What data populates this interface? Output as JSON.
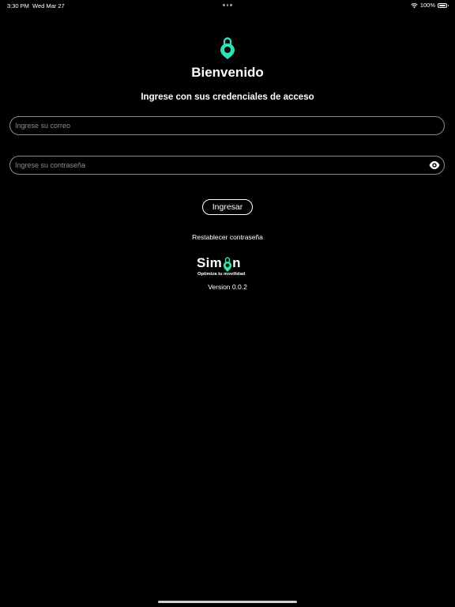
{
  "status_bar": {
    "time": "3:30 PM",
    "date": "Wed Mar 27",
    "battery_percent": "100%",
    "battery_level": 1.0
  },
  "brand": {
    "accent_color": "#2fe0b3",
    "icon": "location-pin-icon"
  },
  "login": {
    "title": "Bienvenido",
    "subtitle": "Ingrese con sus credenciales de acceso",
    "email_placeholder": "Ingrese su correo",
    "email_value": "",
    "password_placeholder": "Ingrese su contraseña",
    "password_value": "",
    "submit_label": "Ingresar",
    "reset_label": "Restablecer contraseña"
  },
  "logo": {
    "word_start": "Sim",
    "word_end": "n",
    "tagline": "Optimiza tu movilidad"
  },
  "version": "Version 0.0.2"
}
